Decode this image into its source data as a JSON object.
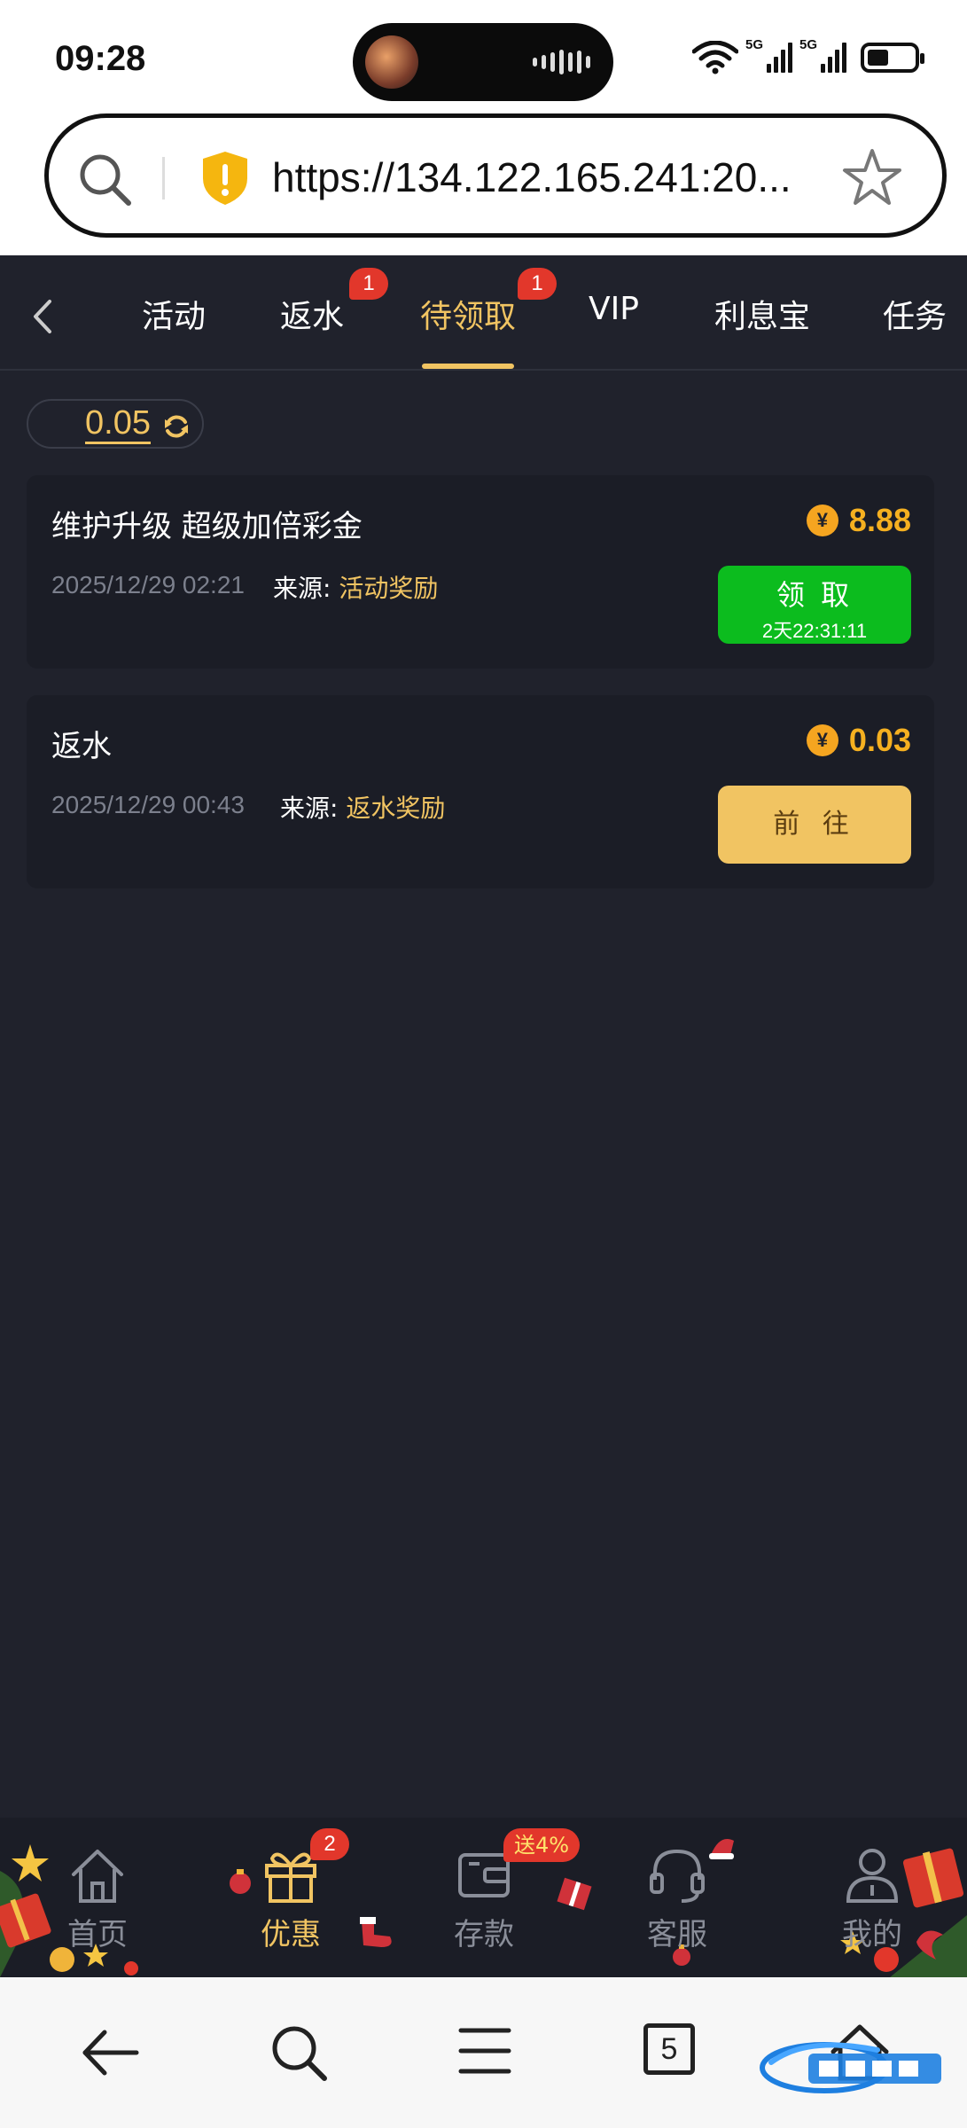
{
  "status_bar": {
    "time": "09:28",
    "signal1_label": "5G",
    "signal2_label": "5G",
    "battery_percent": 45
  },
  "browser": {
    "url": "https://134.122.165.241:20..."
  },
  "tabs": [
    {
      "label": "活动"
    },
    {
      "label": "返水",
      "badge": "1"
    },
    {
      "label": "待领取",
      "badge": "1",
      "active": true
    },
    {
      "label": "VIP"
    },
    {
      "label": "利息宝"
    },
    {
      "label": "任务"
    }
  ],
  "balance": {
    "value": "0.05"
  },
  "rewards": [
    {
      "title": "维护升级 超级加倍彩金",
      "date": "2025/12/29 02:21",
      "source_label": "来源: ",
      "source_value": "活动奖励",
      "coin_symbol": "¥",
      "amount": "8.88",
      "button_label": "领 取",
      "countdown": "2天22:31:11"
    },
    {
      "title": "返水",
      "date": "2025/12/29 00:43",
      "source_label": "来源: ",
      "source_value": "返水奖励",
      "coin_symbol": "¥",
      "amount": "0.03",
      "button_label": "前 往"
    }
  ],
  "bottom_nav": [
    {
      "label": "首页",
      "icon": "home-icon"
    },
    {
      "label": "优惠",
      "icon": "gift-icon",
      "badge": "2",
      "active": true
    },
    {
      "label": "存款",
      "icon": "wallet-icon",
      "badge": "送4%"
    },
    {
      "label": "客服",
      "icon": "headset-icon"
    },
    {
      "label": "我的",
      "icon": "user-icon"
    }
  ],
  "system_nav": {
    "tab_count": "5"
  },
  "colors": {
    "background": "#20222c",
    "card": "#1b1d26",
    "accent_gold": "#f1c462",
    "claim_green": "#0cbc1e",
    "badge_red": "#e2372b"
  }
}
